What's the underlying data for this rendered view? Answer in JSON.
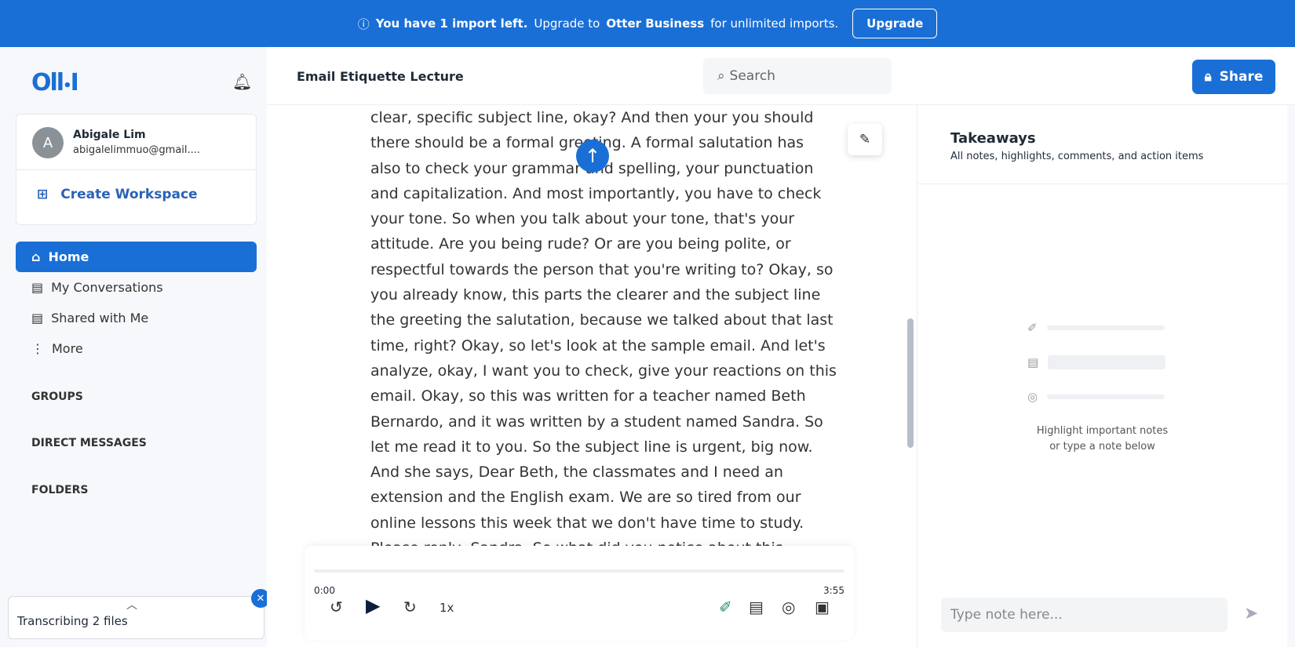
{
  "banner": {
    "pre": "You have 1 import left.",
    "mid": "Upgrade to",
    "brand": "Otter Business",
    "post": "for unlimited imports.",
    "button": "Upgrade"
  },
  "sidebar": {
    "logo": "Oll•I",
    "user": {
      "initial": "A",
      "name": "Abigale Lim",
      "email": "abigalelimmuo@gmail...."
    },
    "create_workspace": "Create Workspace",
    "items": [
      {
        "label": "Home",
        "icon": "home-icon"
      },
      {
        "label": "My Conversations",
        "icon": "document-icon"
      },
      {
        "label": "Shared with Me",
        "icon": "shared-icon"
      },
      {
        "label": "More",
        "icon": "more-vertical-icon"
      }
    ],
    "sections": [
      "GROUPS",
      "DIRECT MESSAGES",
      "FOLDERS"
    ],
    "transcribing": "Transcribing 2 files"
  },
  "header": {
    "title": "Email Etiquette Lecture",
    "search_placeholder": "Search",
    "share": "Share"
  },
  "transcript": [
    "clear, specific subject line, okay? And then your you should",
    "there should be a formal greeting. A formal salutation has",
    "also to check your grammar and spelling, your punctuation",
    "and capitalization. And most importantly, you have to check",
    "your tone. So when you talk about your tone, that's your",
    "attitude. Are you being rude? Or are you being polite, or",
    "respectful towards the person that you're writing to? Okay, so",
    "you already know, this parts the clearer and the subject line",
    "the greeting the salutation, because we talked about that last",
    "time, right? Okay, so let's look at the sample email. And let's",
    "analyze, okay, I want you to check, give your reactions on this",
    "email. Okay, so this was written for a teacher named Beth",
    "Bernardo, and it was written by a student named Sandra. So",
    "let me read it to you. So the subject line is urgent, big now.",
    "And she says, Dear Beth, the classmates and I need an",
    "extension and the English exam. We are so tired from our",
    "online lessons this week that we don't have time to study.",
    "Please reply, Sandra. So what did you notice about this"
  ],
  "player": {
    "current": "0:00",
    "duration": "3:55",
    "speed": "1x",
    "progress": 0
  },
  "takeaways": {
    "title": "Takeaways",
    "subtitle": "All notes, highlights, comments, and action items",
    "hint1": "Highlight important notes",
    "hint2": "or type a note below",
    "note_placeholder": "Type note here..."
  },
  "colors": {
    "accent": "#1a6fd6"
  }
}
